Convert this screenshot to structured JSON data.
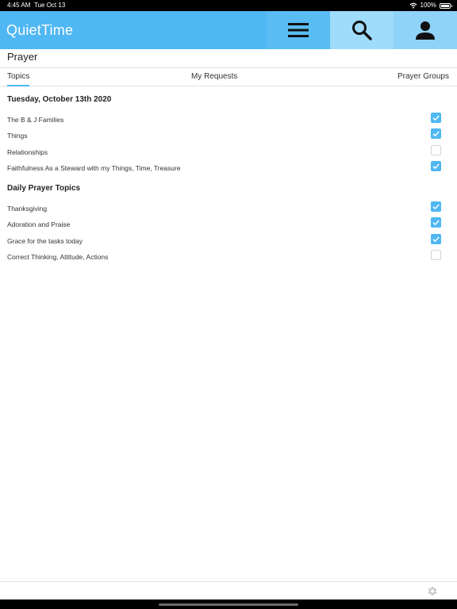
{
  "status": {
    "time": "4:45 AM",
    "date": "Tue Oct 13",
    "battery": "100%"
  },
  "app": {
    "title": "QuietTime"
  },
  "nav": {
    "menu": "menu-icon",
    "search": "search-icon",
    "profile": "profile-icon"
  },
  "page": {
    "title": "Prayer"
  },
  "tabs": [
    {
      "label": "Topics",
      "active": true
    },
    {
      "label": "My Requests",
      "active": false
    },
    {
      "label": "Prayer Groups",
      "active": false
    }
  ],
  "sections": [
    {
      "heading": "Tuesday, October 13th 2020",
      "items": [
        {
          "label": "The B & J Families",
          "checked": true
        },
        {
          "label": "Things",
          "checked": true
        },
        {
          "label": "Relationships",
          "checked": false
        },
        {
          "label": "Faithfulness As a Steward with my Things, Time, Treasure",
          "checked": true
        }
      ]
    },
    {
      "heading": "Daily Prayer Topics",
      "items": [
        {
          "label": "Thanksgiving",
          "checked": true
        },
        {
          "label": "Adoration and Praise",
          "checked": true
        },
        {
          "label": "Grace for the tasks today",
          "checked": true
        },
        {
          "label": "Correct Thinking, Attitude, Actions",
          "checked": false
        }
      ]
    }
  ],
  "footer": {
    "settings": "gear-icon"
  },
  "colors": {
    "accent": "#4fb7f3",
    "menu_bg": "#59bdf4",
    "search_bg": "#9fdbfa",
    "profile_bg": "#8fd3f9"
  }
}
